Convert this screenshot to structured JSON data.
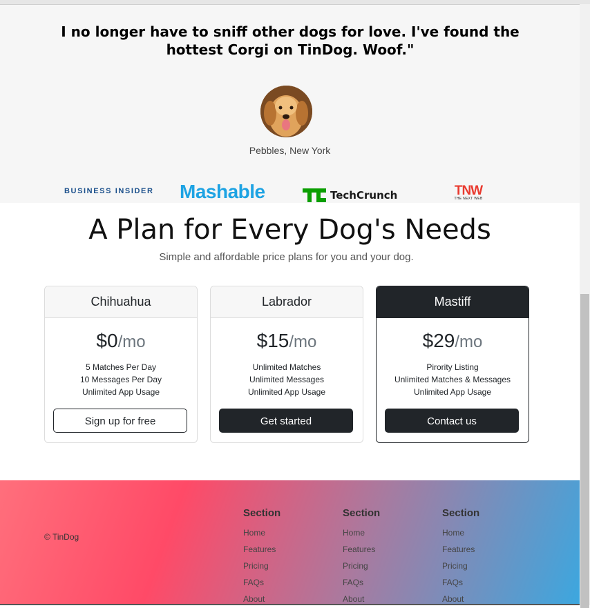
{
  "testimonial": {
    "quote": "I no longer have to sniff other dogs for love. I've found the hottest Corgi on TinDog. Woof.\"",
    "person": "Pebbles, New York"
  },
  "press": {
    "business_insider": "BUSINESS INSIDER",
    "mashable": "Mashable",
    "techcrunch": "TechCrunch",
    "tnw": "TNW",
    "tnw_tag": "THE NEXT WEB"
  },
  "pricing": {
    "title": "A Plan for Every Dog's Needs",
    "subtitle": "Simple and affordable price plans for you and your dog.",
    "plans": [
      {
        "name": "Chihuahua",
        "price": "$0",
        "period": "/mo",
        "features": [
          "5 Matches Per Day",
          "10 Messages Per Day",
          "Unlimited App Usage"
        ],
        "button": "Sign up for free"
      },
      {
        "name": "Labrador",
        "price": "$15",
        "period": "/mo",
        "features": [
          "Unlimited Matches",
          "Unlimited Messages",
          "Unlimited App Usage"
        ],
        "button": "Get started"
      },
      {
        "name": "Mastiff",
        "price": "$29",
        "period": "/mo",
        "features": [
          "Pirority Listing",
          "Unlimited Matches & Messages",
          "Unlimited App Usage"
        ],
        "button": "Contact us"
      }
    ]
  },
  "footer": {
    "copyright": "© TinDog",
    "columns": [
      {
        "heading": "Section",
        "links": [
          "Home",
          "Features",
          "Pricing",
          "FAQs",
          "About"
        ]
      },
      {
        "heading": "Section",
        "links": [
          "Home",
          "Features",
          "Pricing",
          "FAQs",
          "About"
        ]
      },
      {
        "heading": "Section",
        "links": [
          "Home",
          "Features",
          "Pricing",
          "FAQs",
          "About"
        ]
      }
    ]
  },
  "colors": {
    "dark": "#212529",
    "footer_gradient_start": "#ff4a67",
    "footer_gradient_end": "#3ca7df",
    "mashable_blue": "#1ea3e3",
    "techcrunch_green": "#0a9e01",
    "tnw_red": "#e93a2f"
  }
}
